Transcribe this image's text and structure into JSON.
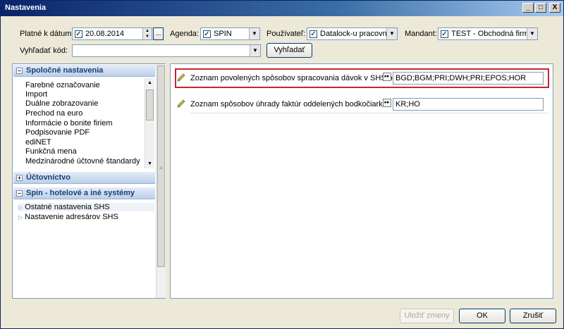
{
  "window": {
    "title": "Nastavenia"
  },
  "titlebar_buttons": {
    "minimize": "_",
    "maximize": "□",
    "close": "X"
  },
  "filters": {
    "date_label": "Platné k dátumu:",
    "date_value": "20.08.2014",
    "agenda_label": "Agenda:",
    "agenda_value": "SPIN",
    "user_label": "Používateľ:",
    "user_value": "Datalock-u pracovník",
    "mandant_label": "Mandant:",
    "mandant_value": "TEST - Obchodná firma",
    "search_label": "Vyhľadať kód:",
    "search_value": "",
    "search_button": "Vyhľadať"
  },
  "left": {
    "section1": {
      "title": "Spoločné nastavenia",
      "items": [
        "Farebné označovanie",
        "Import",
        "Duálne zobrazovanie",
        "Prechod na euro",
        "Informácie o bonite firiem",
        "Podpisovanie PDF",
        "ediNET",
        "Funkčná mena",
        "Medzinárodné účtovné štandardy"
      ]
    },
    "section2": {
      "title": "Účtovníctvo"
    },
    "section3": {
      "title": "Spin - hotelové a iné systémy",
      "items": [
        "Ostatné nastavenia SHS",
        "Nastavenie adresárov SHS"
      ]
    }
  },
  "settings": [
    {
      "label": "Zoznam povolených spôsobov spracovania dávok v SHS oddel",
      "value": "BGD;BGM;PRI;DWH;PRI;EPOS;HOR"
    },
    {
      "label": "Zoznam spôsobov úhrady faktúr oddelených bodkočiarkou pre",
      "value": "KR;HO"
    }
  ],
  "buttons": {
    "save": "Uložiť zmeny",
    "ok": "OK",
    "cancel": "Zrušiť"
  },
  "colors": {
    "highlight": "#c9252e",
    "titlebar": "#0a246a"
  }
}
